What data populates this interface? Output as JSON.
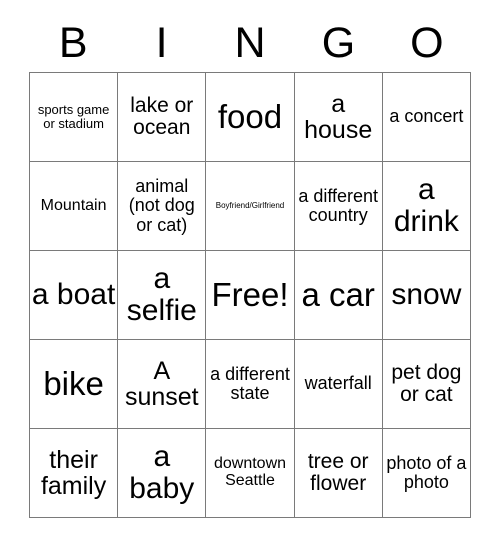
{
  "card": {
    "title_letters": [
      "B",
      "I",
      "N",
      "G",
      "O"
    ],
    "columns": 5,
    "rows": 5,
    "free_space_label": "Free!",
    "grid_line_color": "#7a7a7a",
    "text_color": "#000000",
    "background_color": "#ffffff",
    "cells": [
      [
        {
          "text": "sports game or stadium",
          "size": "xs"
        },
        {
          "text": "lake or ocean",
          "size": "l"
        },
        {
          "text": "food",
          "size": "h"
        },
        {
          "text": "a house",
          "size": "xl"
        },
        {
          "text": "a concert",
          "size": "m"
        }
      ],
      [
        {
          "text": "Mountain",
          "size": "s"
        },
        {
          "text": "animal (not dog or cat)",
          "size": "m"
        },
        {
          "text": "Boyfriend/Girlfriend",
          "size": "xxs"
        },
        {
          "text": "a different country",
          "size": "m"
        },
        {
          "text": "a drink",
          "size": "xxl"
        }
      ],
      [
        {
          "text": "a boat",
          "size": "xxl"
        },
        {
          "text": "a selfie",
          "size": "xxl"
        },
        {
          "text": "Free!",
          "size": "h"
        },
        {
          "text": "a car",
          "size": "h"
        },
        {
          "text": "snow",
          "size": "xxl"
        }
      ],
      [
        {
          "text": "bike",
          "size": "h"
        },
        {
          "text": "A sunset",
          "size": "xl"
        },
        {
          "text": "a different state",
          "size": "m"
        },
        {
          "text": "waterfall",
          "size": "m"
        },
        {
          "text": "pet dog or cat",
          "size": "l"
        }
      ],
      [
        {
          "text": "their family",
          "size": "xl"
        },
        {
          "text": "a baby",
          "size": "xxl"
        },
        {
          "text": "downtown Seattle",
          "size": "s"
        },
        {
          "text": "tree or flower",
          "size": "l"
        },
        {
          "text": "photo of a photo",
          "size": "m"
        }
      ]
    ]
  }
}
